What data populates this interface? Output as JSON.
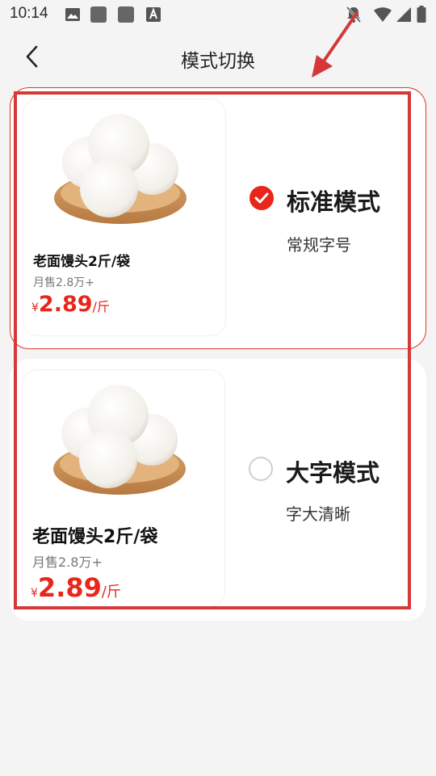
{
  "status_bar": {
    "time": "10:14",
    "left_icons": [
      "image-icon",
      "square-icon",
      "square-icon",
      "text-a-icon"
    ],
    "right_icons": [
      "bell-off-icon",
      "wifi-icon",
      "signal-icon",
      "battery-icon"
    ]
  },
  "header": {
    "title": "模式切换",
    "back_icon": "chevron-left-icon"
  },
  "modes": [
    {
      "selected": true,
      "title": "标准模式",
      "subtitle": "常规字号",
      "product": {
        "name": "老面馒头2斤/袋",
        "sales": "月售2.8万+",
        "currency": "¥",
        "price": "2.89",
        "unit": "/斤"
      }
    },
    {
      "selected": false,
      "title": "大字模式",
      "subtitle": "字大清晰",
      "product": {
        "name": "老面馒头2斤/袋",
        "sales": "月售2.8万+",
        "currency": "¥",
        "price": "2.89",
        "unit": "/斤"
      }
    }
  ],
  "colors": {
    "accent": "#e8261a",
    "annotation": "#d6383a",
    "background": "#f4f4f4"
  }
}
